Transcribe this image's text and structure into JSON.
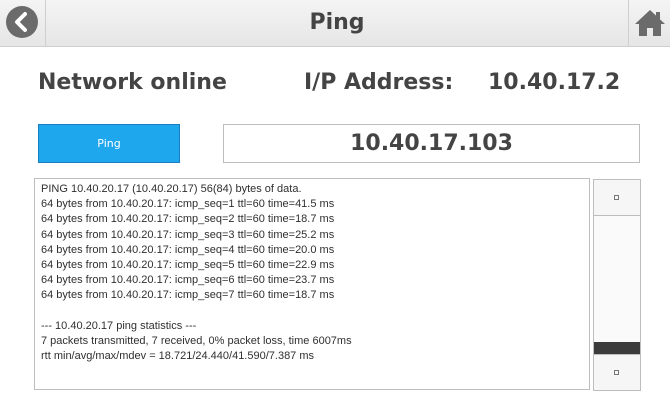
{
  "header": {
    "title": "Ping",
    "back_icon": "chevron-left-icon",
    "home_icon": "home-icon"
  },
  "status": {
    "network": "Network online",
    "ip_label": "I/P Address:",
    "ip_value": "10.40.17.2"
  },
  "controls": {
    "ping_label": "Ping",
    "target_ip": "10.40.17.103"
  },
  "output": {
    "lines": [
      "PING 10.40.20.17 (10.40.20.17) 56(84) bytes of data.",
      "64 bytes from 10.40.20.17: icmp_seq=1 ttl=60 time=41.5 ms",
      "64 bytes from 10.40.20.17: icmp_seq=2 ttl=60 time=18.7 ms",
      "64 bytes from 10.40.20.17: icmp_seq=3 ttl=60 time=25.2 ms",
      "64 bytes from 10.40.20.17: icmp_seq=4 ttl=60 time=20.0 ms",
      "64 bytes from 10.40.20.17: icmp_seq=5 ttl=60 time=22.9 ms",
      "64 bytes from 10.40.20.17: icmp_seq=6 ttl=60 time=23.7 ms",
      "64 bytes from 10.40.20.17: icmp_seq=7 ttl=60 time=18.7 ms",
      "",
      "--- 10.40.20.17 ping statistics ---",
      "7 packets transmitted, 7 received, 0% packet loss, time 6007ms",
      "rtt min/avg/max/mdev = 18.721/24.440/41.590/7.387 ms"
    ]
  },
  "colors": {
    "accent": "#1fa7ee",
    "text": "#444444",
    "header_bg": "#eeeeee"
  }
}
